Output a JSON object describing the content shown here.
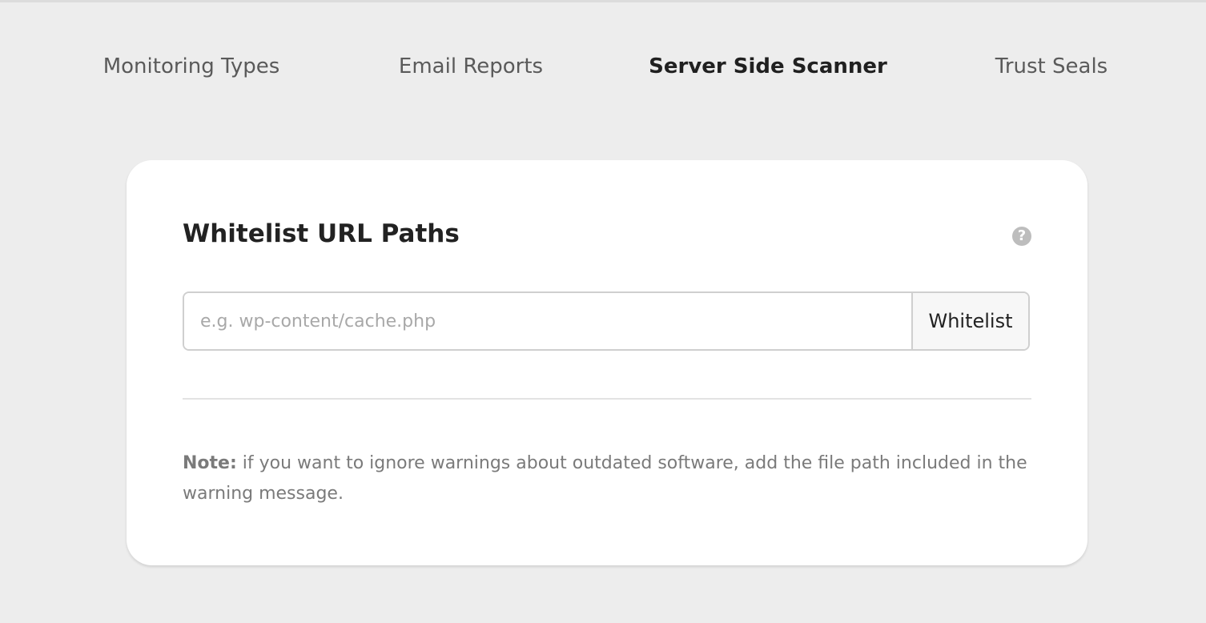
{
  "tabs": [
    {
      "label": "Monitoring Types",
      "active": false
    },
    {
      "label": "Email Reports",
      "active": false
    },
    {
      "label": "Server Side Scanner",
      "active": true
    },
    {
      "label": "Trust Seals",
      "active": false
    }
  ],
  "card": {
    "title": "Whitelist URL Paths",
    "help_icon": "?",
    "input": {
      "value": "",
      "placeholder": "e.g. wp-content/cache.php"
    },
    "button_label": "Whitelist",
    "note_label": "Note:",
    "note_text": " if you want to ignore warnings about outdated software, add the file path included in the warning message."
  },
  "icons": {
    "help": "question-circle-icon"
  },
  "colors": {
    "background": "#ededed",
    "card": "#ffffff",
    "active_tab": "#202020",
    "inactive_tab": "#5a5a5a",
    "help_icon": "#bdbdbd"
  }
}
